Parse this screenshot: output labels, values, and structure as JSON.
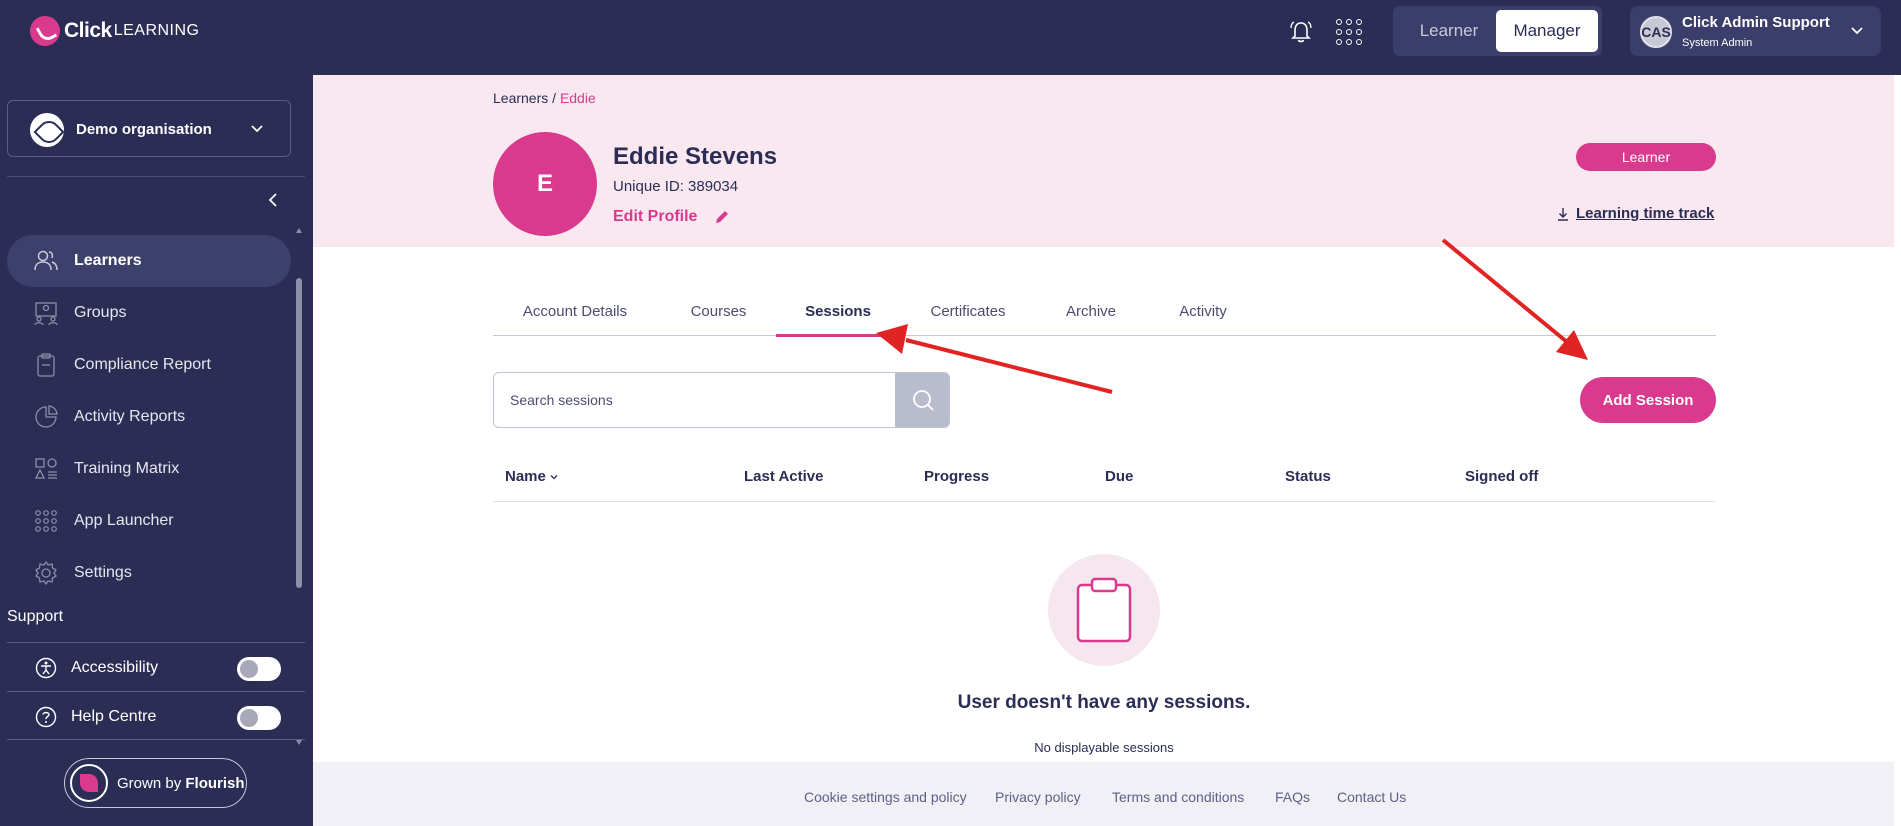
{
  "brand": {
    "logo_click": "Click",
    "logo_learning": "LEARNING",
    "accent": "#d93a8e",
    "navy": "#2b2d55"
  },
  "topbar": {
    "notifications_icon": "bell-icon",
    "apps_icon": "app-grid-icon",
    "role_switch": {
      "learner": "Learner",
      "manager": "Manager",
      "selected": "Manager"
    },
    "user": {
      "initials": "CAS",
      "name": "Click Admin Support",
      "role": "System Admin"
    }
  },
  "sidebar": {
    "organisation": "Demo organisation",
    "items": [
      {
        "label": "Learners",
        "icon": "users-icon",
        "active": true
      },
      {
        "label": "Groups",
        "icon": "groups-icon",
        "active": false
      },
      {
        "label": "Compliance Report",
        "icon": "clipboard-icon",
        "active": false
      },
      {
        "label": "Activity Reports",
        "icon": "pie-chart-icon",
        "active": false
      },
      {
        "label": "Training Matrix",
        "icon": "shapes-icon",
        "active": false
      },
      {
        "label": "App Launcher",
        "icon": "app-grid-icon",
        "active": false
      },
      {
        "label": "Settings",
        "icon": "gear-icon",
        "active": false
      }
    ],
    "support_title": "Support",
    "support_items": [
      {
        "label": "Accessibility",
        "icon": "accessibility-icon",
        "toggle": false
      },
      {
        "label": "Help Centre",
        "icon": "help-icon",
        "toggle": false
      }
    ],
    "flourish": {
      "prefix": "Grown by",
      "brand": "Flourish"
    }
  },
  "breadcrumb": {
    "parent": "Learners",
    "separator": " / ",
    "current": "Eddie"
  },
  "profile": {
    "initial": "E",
    "name": "Eddie Stevens",
    "unique_id": "Unique ID: 389034",
    "edit_label": "Edit Profile",
    "role_badge": "Learner",
    "time_track": "Learning time track"
  },
  "tabs": [
    {
      "label": "Account Details",
      "active": false
    },
    {
      "label": "Courses",
      "active": false
    },
    {
      "label": "Sessions",
      "active": true
    },
    {
      "label": "Certificates",
      "active": false
    },
    {
      "label": "Archive",
      "active": false
    },
    {
      "label": "Activity",
      "active": false
    }
  ],
  "search": {
    "placeholder": "Search sessions",
    "value": ""
  },
  "add_session_label": "Add Session",
  "table": {
    "columns": [
      "Name",
      "Last Active",
      "Progress",
      "Due",
      "Status",
      "Signed off"
    ],
    "sorted_column": "Name",
    "rows": []
  },
  "empty_state": {
    "title": "User doesn't have any sessions.",
    "subtitle": "No displayable sessions"
  },
  "footer": {
    "links": [
      "Cookie settings and policy",
      "Privacy policy",
      "Terms and conditions",
      "FAQs",
      "Contact Us"
    ]
  },
  "annotations": {
    "arrow_color": "#e02424"
  }
}
